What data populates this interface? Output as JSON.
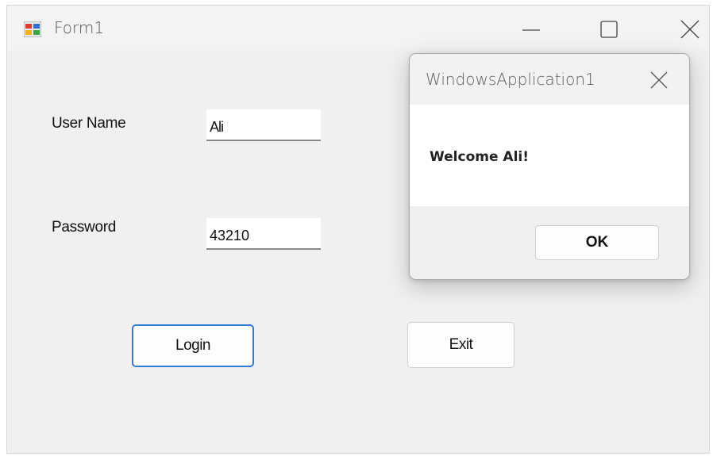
{
  "main_window": {
    "title": "Form1",
    "icon": "winforms-app-icon",
    "controls": {
      "minimize": "minimize-icon",
      "maximize": "maximize-icon",
      "close": "close-icon"
    }
  },
  "form": {
    "username_label": "User Name",
    "username_value": "Ali",
    "password_label": "Password",
    "password_value": "43210",
    "login_label": "Login",
    "exit_label": "Exit"
  },
  "message_box": {
    "title": "WindowsApplication1",
    "message": "Welcome Ali!",
    "ok_label": "OK",
    "close_icon": "close-icon"
  },
  "colors": {
    "window_bg": "#f0f0f0",
    "focus_border": "#2d7bd4",
    "text": "#111111"
  }
}
